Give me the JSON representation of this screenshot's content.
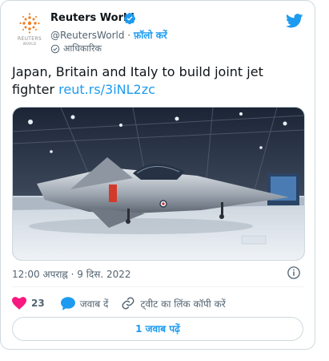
{
  "account": {
    "name": "Reuters World",
    "handle": "@ReutersWorld",
    "separator": "·",
    "follow_label": "फ़ॉलो करें",
    "official_label": "आधिकारिक",
    "logo_text": "REUTERS",
    "logo_subtext": "WORLD"
  },
  "tweet": {
    "text": "Japan, Britain and Italy to build joint jet fighter",
    "link": "reut.rs/3iNL2zc",
    "timestamp": "12:00 अपराह्न · 9 दिस. 2022"
  },
  "actions": {
    "like_count": "23",
    "reply_label": "जवाब दें",
    "copy_link_label": "ट्वीट का लिंक कॉपी करें"
  },
  "replies_button": "1 जवाब पढ़ें",
  "colors": {
    "accent": "#1d9bf0",
    "like": "#f91880",
    "text": "#0f1419",
    "muted": "#536471",
    "verified": "#1d9bf0"
  },
  "icons": [
    "reuters-logo-icon",
    "verified-badge-icon",
    "twitter-bird-icon",
    "official-check-icon",
    "info-icon",
    "heart-icon",
    "reply-bubble-icon",
    "link-icon"
  ]
}
